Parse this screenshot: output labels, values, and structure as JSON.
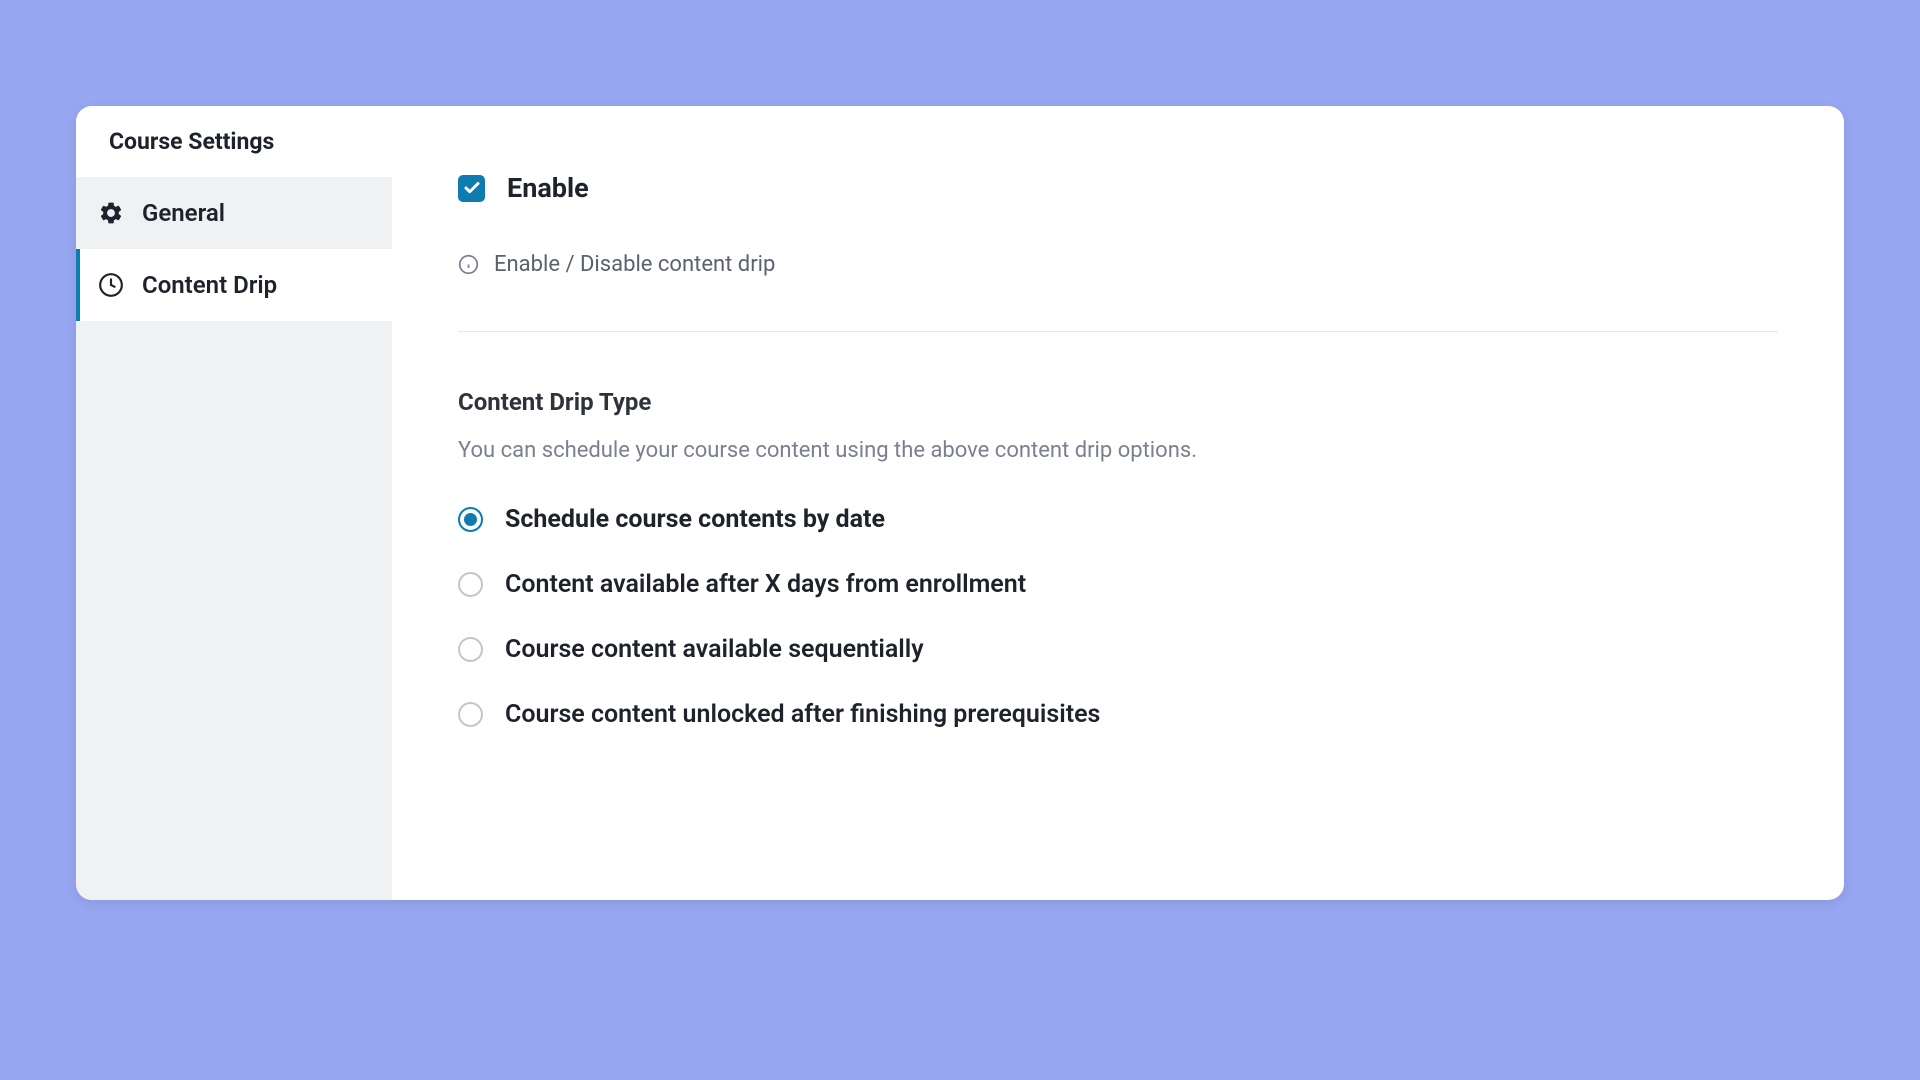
{
  "sidebar": {
    "title": "Course Settings",
    "items": [
      {
        "label": "General",
        "icon": "gear"
      },
      {
        "label": "Content Drip",
        "icon": "clock"
      }
    ]
  },
  "content": {
    "enable": {
      "label": "Enable",
      "checked": true,
      "help": "Enable / Disable content drip"
    },
    "drip_type": {
      "title": "Content Drip Type",
      "description": "You can schedule your course content using the above content drip options.",
      "options": [
        "Schedule course contents by date",
        "Content available after X days from enrollment",
        "Course content available sequentially",
        "Course content unlocked after finishing prerequisites"
      ],
      "selected": 0
    }
  }
}
